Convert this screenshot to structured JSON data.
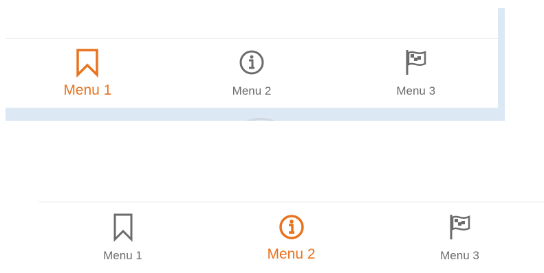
{
  "accent_color": "#e8731f",
  "inactive_color": "#6b6b6b",
  "variants": [
    {
      "active_tab": "Menu 1",
      "tabs": [
        {
          "label": "Menu 1",
          "icon": "bookmark-icon",
          "active": true
        },
        {
          "label": "Menu 2",
          "icon": "info-icon",
          "active": false
        },
        {
          "label": "Menu 3",
          "icon": "flag-icon",
          "active": false
        }
      ]
    },
    {
      "active_tab": "Menu 2",
      "tabs": [
        {
          "label": "Menu 1",
          "icon": "bookmark-icon",
          "active": false
        },
        {
          "label": "Menu 2",
          "icon": "info-icon",
          "active": true
        },
        {
          "label": "Menu 3",
          "icon": "flag-icon",
          "active": false
        }
      ]
    }
  ]
}
